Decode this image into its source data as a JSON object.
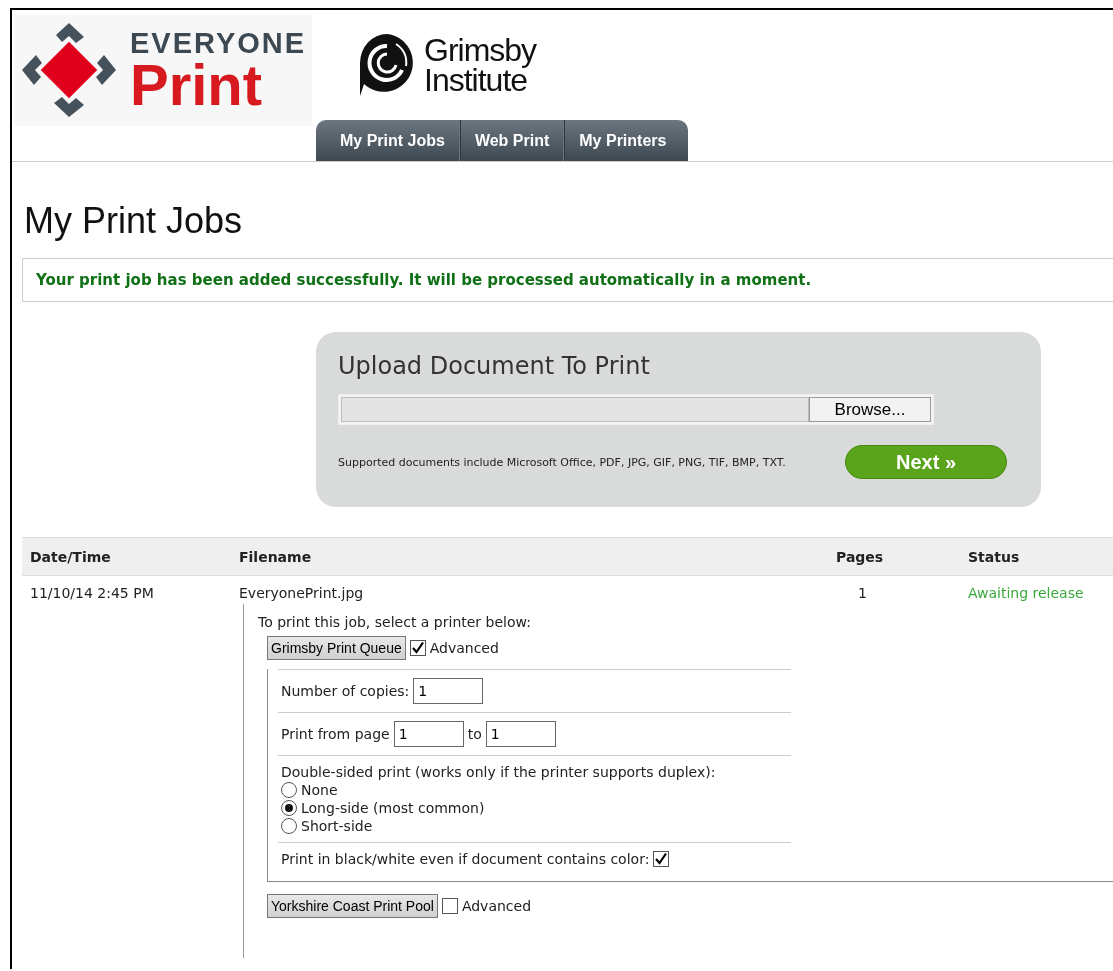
{
  "header": {
    "brand_logo": {
      "top": "EVERYONE",
      "bottom": "Print"
    },
    "institute_logo": {
      "top": "Grimsby",
      "bottom": "Institute"
    }
  },
  "tabs": [
    {
      "label": "My Print Jobs"
    },
    {
      "label": "Web Print"
    },
    {
      "label": "My Printers"
    }
  ],
  "page_title": "My Print Jobs",
  "message": "Your print job has been added successfully. It will be processed automatically in a moment.",
  "upload": {
    "title": "Upload Document To Print",
    "browse_button": "Browse...",
    "note": "Supported documents include Microsoft Office, PDF, JPG, GIF, PNG, TIF, BMP, TXT.",
    "next_button": "Next »"
  },
  "table": {
    "columns": [
      "Date/Time",
      "Filename",
      "Pages",
      "Status"
    ],
    "rows": [
      {
        "date_time": "11/10/14 2:45 PM",
        "filename": "EveryonePrint.jpg",
        "pages": "1",
        "status": "Awaiting release",
        "instruction": "To print this job, select a printer below:",
        "printers": [
          {
            "name": "Grimsby Print Queue",
            "advanced_label": "Advanced",
            "advanced_checked": true,
            "options": {
              "copies_label": "Number of copies:",
              "copies_value": "1",
              "range_label": "Print from page",
              "from_value": "1",
              "to_label": "to",
              "to_value": "1",
              "duplex_label": "Double-sided print (works only if the printer supports duplex):",
              "duplex_options": [
                {
                  "label": "None",
                  "selected": false
                },
                {
                  "label": "Long-side (most common)",
                  "selected": true
                },
                {
                  "label": "Short-side",
                  "selected": false
                }
              ],
              "mono_label": "Print in black/white even if document contains color:",
              "mono_checked": true
            }
          },
          {
            "name": "Yorkshire Coast Print Pool",
            "advanced_label": "Advanced",
            "advanced_checked": false
          }
        ]
      }
    ]
  }
}
